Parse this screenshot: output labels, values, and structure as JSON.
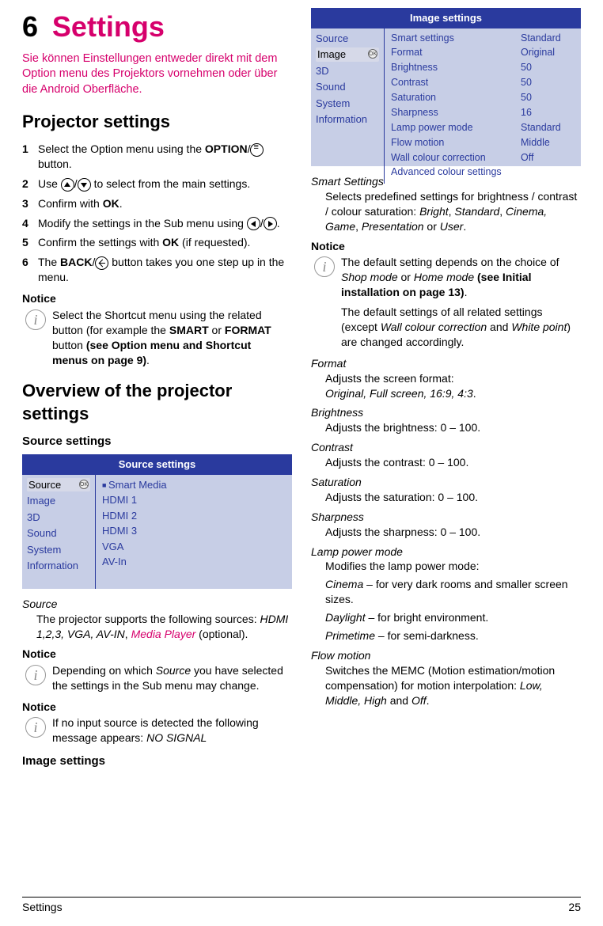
{
  "chapter_number": "6",
  "chapter_title": "Settings",
  "intro": "Sie können Einstellungen entweder direkt mit dem Option menu des Projektors vornehmen oder über die Android Oberfläche.",
  "h2_projector": "Projector settings",
  "steps": {
    "s1a": "Select the Option menu using the ",
    "s1b": "OPTION",
    "s1c": "/",
    "s1d": " button.",
    "s2a": "Use ",
    "s2b": "/",
    "s2c": " to select from the main settings.",
    "s3a": "Confirm with ",
    "s3b": "OK",
    "s3c": ".",
    "s4a": "Modify the settings in the Sub menu using ",
    "s4b": "/",
    "s4c": ".",
    "s5a": "Confirm the settings with ",
    "s5b": "OK",
    "s5c": " (if requested).",
    "s6a": "The ",
    "s6b": "BACK",
    "s6c": "/",
    "s6d": " button takes you one step up in the menu."
  },
  "notice_label": "Notice",
  "notice1": {
    "a": "Select the Shortcut menu using the related button (for example the ",
    "b": "SMART",
    "c": " or ",
    "d": "FORMAT",
    "e": " button ",
    "f": "(see Option menu and Shortcut menus on page 9)",
    "g": "."
  },
  "h2_overview": "Overview of the projector settings",
  "source_heading": "Source settings",
  "menu1": {
    "title": "Source settings",
    "left": [
      "Source",
      "Image",
      "3D",
      "Sound",
      "System",
      "Information"
    ],
    "selected_index": 0,
    "mid": [
      "Smart Media",
      "HDMI 1",
      "HDMI 2",
      "HDMI 3",
      "VGA",
      "AV-In"
    ]
  },
  "source_def": {
    "term": "Source",
    "body_a": "The projector supports the following sources: ",
    "body_b": "HDMI 1,2,3, VGA, AV-IN",
    "body_c": ", ",
    "body_d": "Media Player",
    "body_e": " (optional)."
  },
  "notice2": {
    "a": "Depending on which ",
    "b": "Source",
    "c": " you have selected the settings in the Sub menu may change."
  },
  "notice3": {
    "a": "If no input source is detected the following message appears: ",
    "b": "NO SIGNAL"
  },
  "image_heading": "Image settings",
  "menu2": {
    "title": "Image settings",
    "left": [
      "Source",
      "Image",
      "3D",
      "Sound",
      "System",
      "Information"
    ],
    "selected_index": 1,
    "mid": [
      "Smart settings",
      "Format",
      "Brightness",
      "Contrast",
      "Saturation",
      "Sharpness",
      "Lamp power mode",
      "Flow motion",
      "Wall colour correction",
      "Advanced colour settings"
    ],
    "right": [
      "Standard",
      "Original",
      "50",
      "50",
      "50",
      "16",
      "Standard",
      "Middle",
      "Off"
    ]
  },
  "smart_def": {
    "term": "Smart Settings",
    "body_a": "Selects predefined settings for brightness / contrast / colour saturation: ",
    "body_b": "Bright",
    "body_c": ", ",
    "body_d": "Standard",
    "body_e": ", ",
    "body_f": "Cinema, Game",
    "body_g": ", ",
    "body_h": "Presentation",
    "body_i": " or ",
    "body_j": "User",
    "body_k": "."
  },
  "notice4": {
    "a": "The default setting depends on the choice of ",
    "b": "Shop mode",
    "c": " or ",
    "d": "Home mode",
    "e": " ",
    "f": "(see Initial installation on page 13)",
    "g": ".",
    "p2a": "The default settings of all related settings (except ",
    "p2b": "Wall colour correction",
    "p2c": " and ",
    "p2d": "White point",
    "p2e": ") are changed accordingly."
  },
  "defs": {
    "format_t": "Format",
    "format_b1": "Adjusts the screen format:",
    "format_b2": "Original, Full screen, 16:9, 4:3",
    "brightness_t": "Brightness",
    "brightness_b": "Adjusts the brightness: 0 – 100.",
    "contrast_t": "Contrast",
    "contrast_b": "Adjusts the contrast: 0 – 100.",
    "saturation_t": "Saturation",
    "saturation_b": "Adjusts the saturation: 0 – 100.",
    "sharpness_t": "Sharpness",
    "sharpness_b": "Adjusts the sharpness: 0 – 100.",
    "lamp_t": "Lamp power mode",
    "lamp_b1": "Modifies the lamp power mode:",
    "lamp_c1a": "Cinema",
    "lamp_c1b": " – for very dark rooms and smaller screen sizes.",
    "lamp_c2a": "Daylight",
    "lamp_c2b": " – for bright environment.",
    "lamp_c3a": "Primetime",
    "lamp_c3b": " – for semi-darkness.",
    "flow_t": "Flow motion",
    "flow_b1": "Switches the MEMC (Motion estimation/motion compensation) for motion interpolation: ",
    "flow_b2": "Low, Middle, High",
    "flow_b3": " and ",
    "flow_b4": "Off",
    "flow_b5": "."
  },
  "footer_left": "Settings",
  "footer_right": "25"
}
